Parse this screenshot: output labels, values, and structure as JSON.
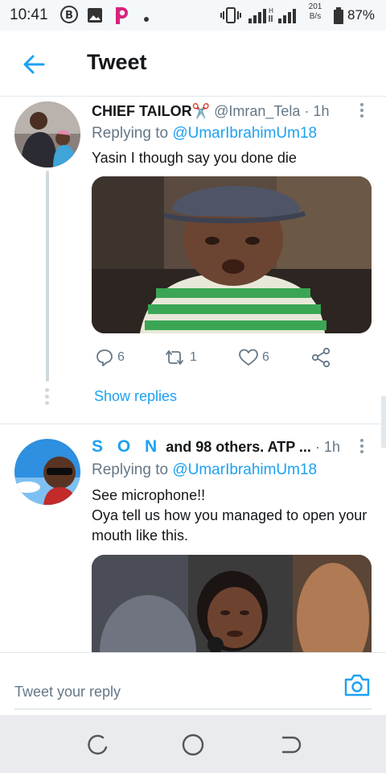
{
  "status_bar": {
    "time": "10:41",
    "network_speed_value": "201",
    "network_speed_unit": "B/s",
    "battery_percent": "87%"
  },
  "header": {
    "title": "Tweet"
  },
  "tweets": [
    {
      "display_name": "CHIEF TAILOR",
      "name_emoji": "✂️",
      "handle": "@Imran_Tela",
      "time": "· 1h",
      "replying_label": "Replying to",
      "replying_to": "@UmarIbrahimUm18",
      "text": "Yasin I though say you done die",
      "replies": "6",
      "retweets": "1",
      "likes": "6",
      "show_replies": "Show replies"
    },
    {
      "display_name_letters": "S O N",
      "display_name_rest": "and 98 others. ATP ...",
      "time": "· 1h",
      "replying_label": "Replying to",
      "replying_to": "@UmarIbrahimUm18",
      "text_line1": "See microphone!!",
      "text_line2": "Oya tell us how you managed to open your mouth like this."
    }
  ],
  "reply_bar": {
    "placeholder": "Tweet your reply"
  },
  "colors": {
    "accent": "#1da1f2",
    "secondary_text": "#657786",
    "primary_text": "#14171a"
  },
  "icons": [
    "back-arrow-icon",
    "reply-icon",
    "retweet-icon",
    "like-icon",
    "share-icon",
    "camera-icon",
    "more-icon"
  ]
}
